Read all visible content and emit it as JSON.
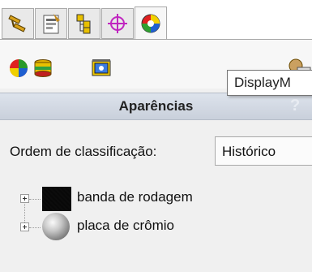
{
  "tabs": [
    {
      "name": "feature-manager-tab",
      "icon": "feature-tree-icon"
    },
    {
      "name": "property-manager-tab",
      "icon": "property-manager-icon"
    },
    {
      "name": "configuration-manager-tab",
      "icon": "configuration-manager-icon"
    },
    {
      "name": "dimxpert-manager-tab",
      "icon": "dimxpert-icon"
    },
    {
      "name": "display-manager-tab",
      "icon": "display-manager-icon",
      "active": true
    }
  ],
  "toolbar": {
    "buttons": [
      "appearances-icon",
      "decals-icon",
      "scenes-lights-cameras-icon"
    ],
    "right_icon": "display-manager-small-icon"
  },
  "tooltip": "DisplayM",
  "panel": {
    "title": "Aparências",
    "help": "?"
  },
  "sort": {
    "label": "Ordem de classificação:",
    "value": "Histórico"
  },
  "tree": [
    {
      "label": "banda de rodagem",
      "swatch": "dark-tread-texture"
    },
    {
      "label": "placa de crômio",
      "swatch": "chrome-sphere"
    }
  ]
}
